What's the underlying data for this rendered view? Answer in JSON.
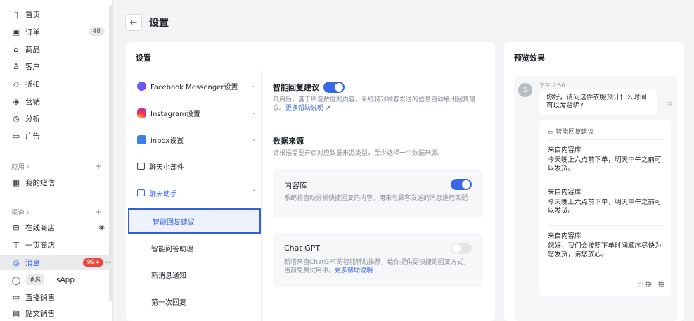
{
  "sidebar": {
    "items": [
      {
        "icon": "home-icon",
        "glyph": "▯",
        "label": "首页"
      },
      {
        "icon": "order-icon",
        "glyph": "▣",
        "label": "订单",
        "badge": "48"
      },
      {
        "icon": "product-icon",
        "glyph": "⌂",
        "label": "商品"
      },
      {
        "icon": "customer-icon",
        "glyph": "♙",
        "label": "客户"
      },
      {
        "icon": "discount-icon",
        "glyph": "◇",
        "label": "折扣"
      },
      {
        "icon": "marketing-icon",
        "glyph": "◈",
        "label": "营销"
      },
      {
        "icon": "analytics-icon",
        "glyph": "◷",
        "label": "分析"
      },
      {
        "icon": "ads-icon",
        "glyph": "▭",
        "label": "广告"
      }
    ],
    "apps_section": "应用 ›",
    "apps_items": [
      {
        "icon": "sms-icon",
        "glyph": "▦",
        "label": "我的短信"
      }
    ],
    "channels_section": "渠道 ›",
    "channel_items": [
      {
        "icon": "store-icon",
        "glyph": "⊟",
        "label": "在线商店",
        "eye": "◉"
      },
      {
        "icon": "onepage-icon",
        "glyph": "⊤",
        "label": "一页商店"
      },
      {
        "icon": "message-icon",
        "glyph": "◎",
        "label": "消息",
        "badge": "99+",
        "more": "···"
      },
      {
        "icon": "whatsapp-icon",
        "glyph": "◯",
        "label": "sApp"
      },
      {
        "icon": "live-icon",
        "glyph": "▭",
        "label": "直播销售"
      },
      {
        "icon": "post-icon",
        "glyph": "▤",
        "label": "贴文销售"
      }
    ],
    "tooltip": "消息",
    "plus": "+"
  },
  "header": {
    "back_glyph": "←",
    "title": "设置"
  },
  "settings": {
    "card_title": "设置",
    "nav": [
      {
        "label": "Facebook Messenger设置",
        "chev": "⌄"
      },
      {
        "label": "Instagram设置",
        "chev": "⌄"
      },
      {
        "label": "inbox设置",
        "chev": "⌄"
      },
      {
        "label": "聊天小部件"
      },
      {
        "label": "聊天助手",
        "chev": "⌃"
      }
    ],
    "sub_nav": [
      "智能回复建议",
      "智能问答助理",
      "新消息通知",
      "第一次回复"
    ],
    "smart_reply": {
      "title": "智能回复建议",
      "desc": "开启后，基于所选数据的内容，系统将对顾客发送的信息自动给出回复建议。",
      "link": "更多帮助说明 ↗",
      "enabled": true
    },
    "data_source": {
      "title": "数据来源",
      "desc": "请根据需要开启对应数据来源类型，至少选择一个数据来源。",
      "sources": [
        {
          "name": "内容库",
          "desc": "系统将自动分析快捷回复的内容，用来与顾客发送的消息进行匹配",
          "enabled": true
        },
        {
          "name": "Chat GPT",
          "desc": "新增来自ChatGPT的智能辅助推荐，给你提供更快捷的回复方式，当前免费试用中。",
          "link": "更多帮助说明",
          "enabled": false
        }
      ]
    }
  },
  "preview": {
    "title": "预览效果",
    "avatar": "S",
    "time": "下午 2:56",
    "question": "你好，请问这件衣服预计什么时间可以发货呢?",
    "suggest_header": "智能回复建议",
    "suggestions": [
      {
        "source": "来自内容库",
        "text": "今天晚上六点前下单，明天中午之前可以发货。"
      },
      {
        "source": "来自内容库",
        "text": "今天晚上六点前下单，明天中午之前可以发货。"
      },
      {
        "source": "来自内容库",
        "text": "您好，我们会按照下单时间顺序尽快为您发货，请您放心。"
      }
    ],
    "refresh": "换一换"
  },
  "colors": {
    "accent": "#3868e8",
    "badge_red": "#f0443d",
    "selected_border": "#2f61d8"
  }
}
